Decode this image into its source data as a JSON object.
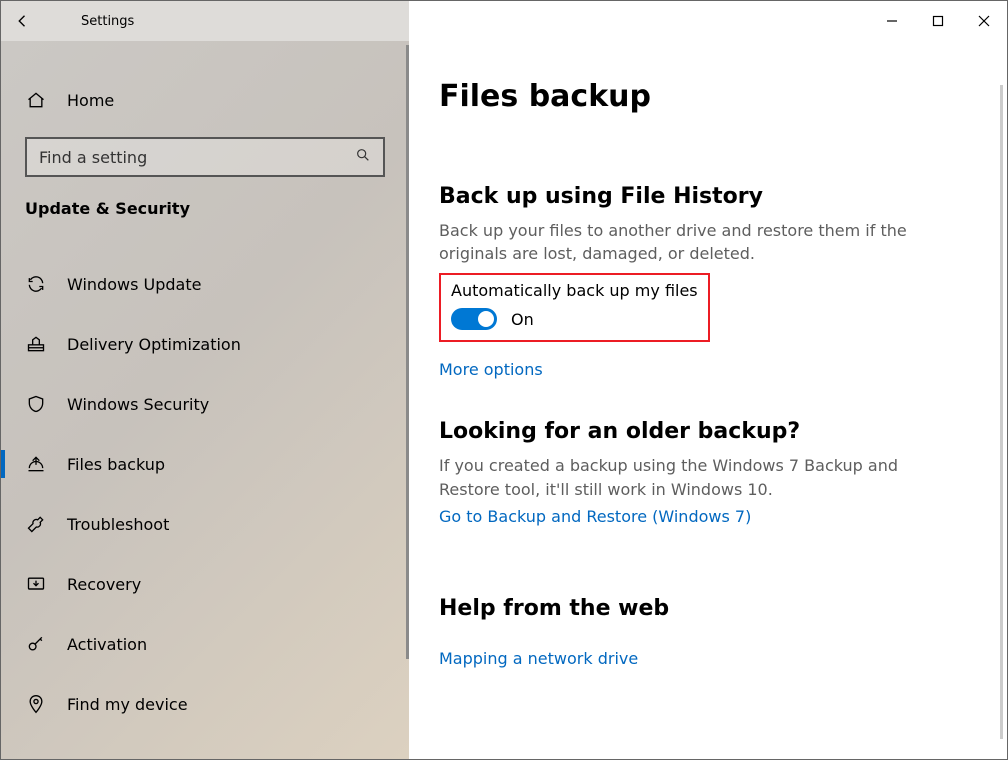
{
  "app_title": "Settings",
  "search": {
    "placeholder": "Find a setting"
  },
  "home_label": "Home",
  "section_header": "Update & Security",
  "nav": [
    {
      "label": "Windows Update"
    },
    {
      "label": "Delivery Optimization"
    },
    {
      "label": "Windows Security"
    },
    {
      "label": "Files backup"
    },
    {
      "label": "Troubleshoot"
    },
    {
      "label": "Recovery"
    },
    {
      "label": "Activation"
    },
    {
      "label": "Find my device"
    }
  ],
  "page": {
    "title": "Files backup",
    "s1": {
      "heading": "Back up using File History",
      "desc": "Back up your files to another drive and restore them if the originals are lost, damaged, or deleted.",
      "toggle_label": "Automatically back up my files",
      "toggle_state": "On",
      "link": "More options"
    },
    "s2": {
      "heading": "Looking for an older backup?",
      "desc": "If you created a backup using the Windows 7 Backup and Restore tool, it'll still work in Windows 10.",
      "link": "Go to Backup and Restore (Windows 7)"
    },
    "s3": {
      "heading": "Help from the web",
      "link": "Mapping a network drive"
    }
  }
}
